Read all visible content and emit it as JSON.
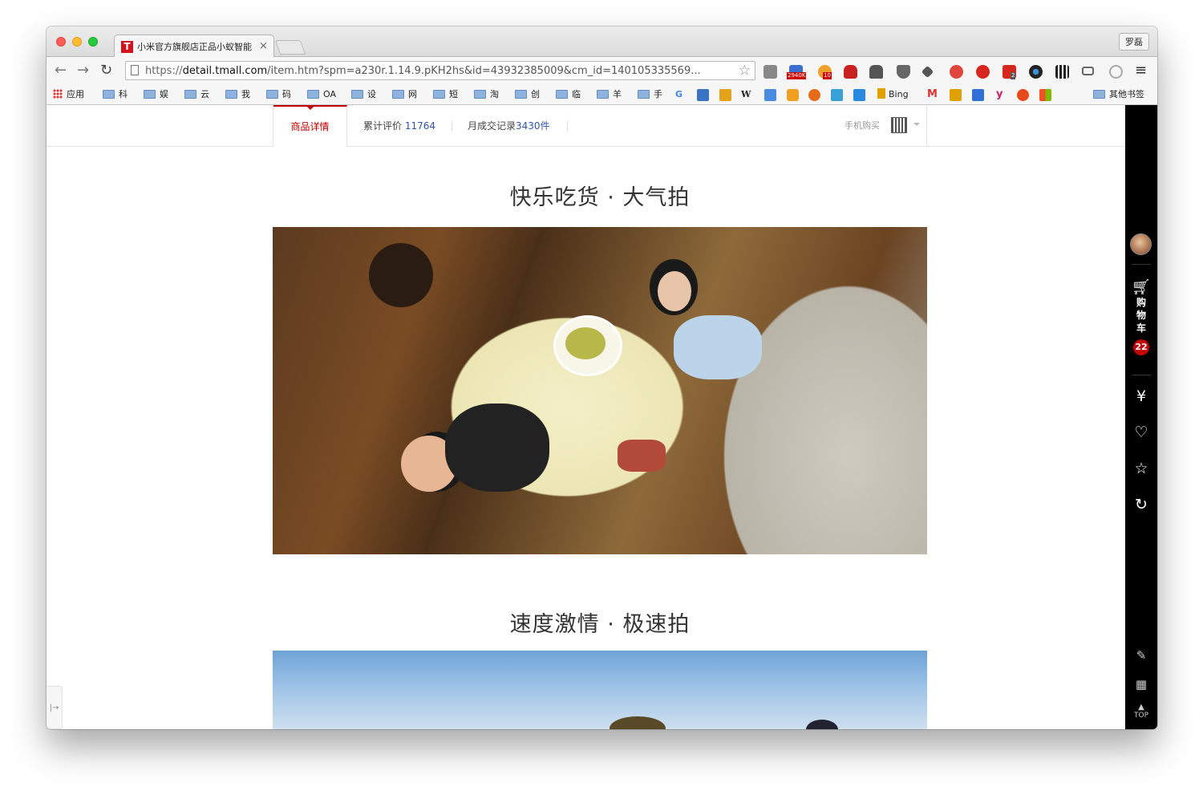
{
  "browser": {
    "tab_title": "小米官方旗舰店正品小蚁智能",
    "tab_favicon": "T",
    "tab_close": "×",
    "profile_name": "罗磊",
    "url_prefix": "https://",
    "url_host": "detail.tmall.com",
    "url_rest": "/item.htm?spm=a230r.1.14.9.pKH2hs&id=43932385009&cm_id=140105335569...",
    "extension_badges": {
      "ext2": "2940K",
      "ext3": "10",
      "ext9": "2"
    }
  },
  "bookmarks": {
    "apps": "应用",
    "folders": [
      "科",
      "娱",
      "云",
      "我",
      "码",
      "OA",
      "设",
      "网",
      "短",
      "淘",
      "创",
      "临",
      "羊",
      "手"
    ],
    "bing": "Bing",
    "other": "其他书签",
    "gmail": "M",
    "yahoo": "y",
    "wiki": "W",
    "google": "G"
  },
  "page": {
    "tabs": {
      "detail": "商品详情",
      "reviews_label": "累计评价",
      "reviews_count": "11764",
      "sales_label": "月成交记录",
      "sales_count": "3430件",
      "mobile_buy": "手机购买"
    },
    "sections": [
      {
        "title": "快乐吃货 · 大气拍"
      },
      {
        "title": "速度激情 · 极速拍"
      }
    ]
  },
  "sidebar": {
    "cart_chars": [
      "购",
      "物",
      "车"
    ],
    "cart_count": "22",
    "currency": "¥",
    "top_label": "TOP"
  },
  "colors": {
    "accent": "#c40000",
    "link": "#3355aa",
    "sidebar_bg": "#000000"
  }
}
